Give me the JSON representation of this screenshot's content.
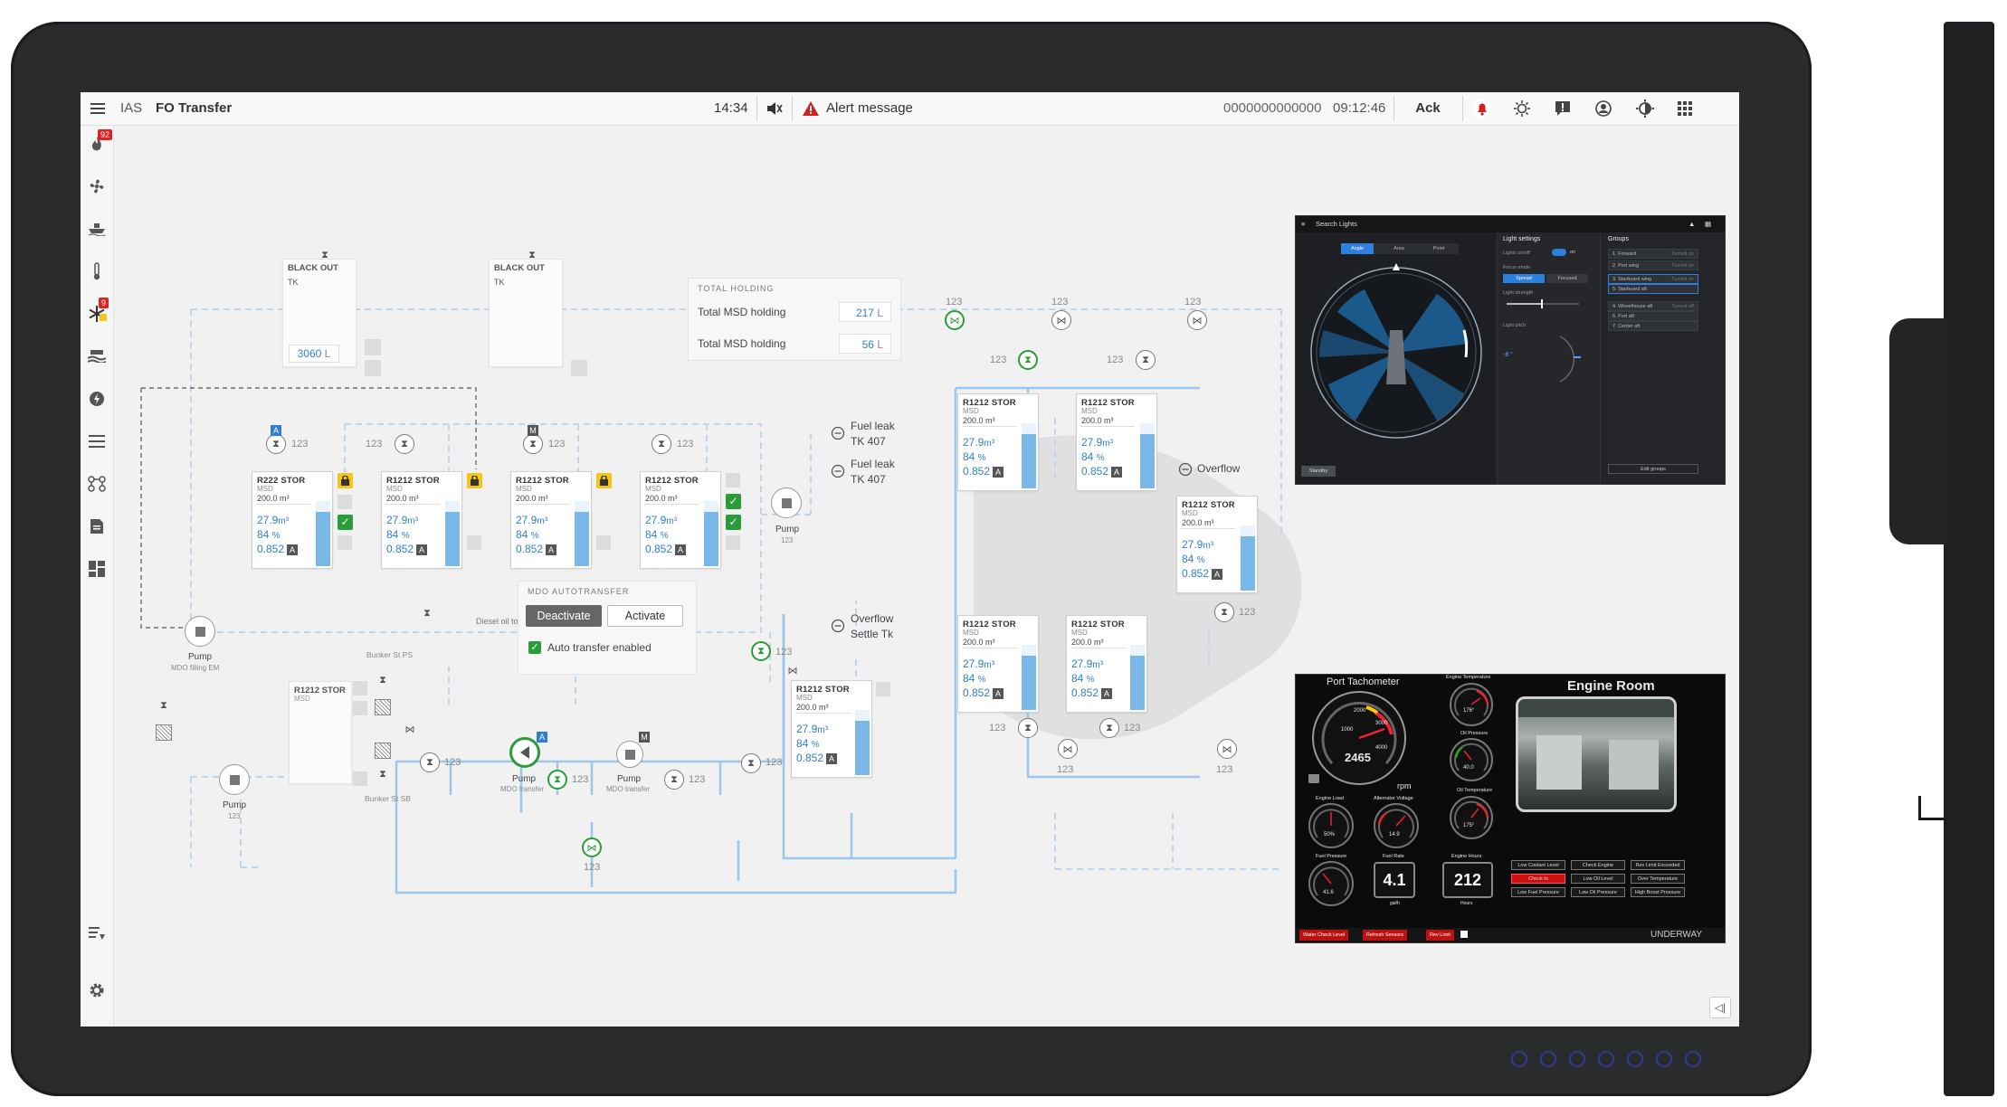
{
  "topbar": {
    "system": "IAS",
    "title": "FO Transfer",
    "time": "14:34",
    "alert_message": "Alert message",
    "alert_id": "0000000000000",
    "alert_time": "09:12:46",
    "ack_label": "Ack"
  },
  "sidebar": {
    "items": [
      {
        "icon": "flame-icon",
        "badge": "92"
      },
      {
        "icon": "fan-icon"
      },
      {
        "icon": "ship-icon"
      },
      {
        "icon": "thermometer-icon"
      },
      {
        "icon": "snowflake-icon",
        "badge": "9"
      },
      {
        "icon": "waves-icon"
      },
      {
        "icon": "power-icon"
      },
      {
        "icon": "list-icon"
      },
      {
        "icon": "network-icon"
      },
      {
        "icon": "document-icon"
      },
      {
        "icon": "dashboard-icon"
      },
      {
        "icon": "filter-list-icon"
      },
      {
        "icon": "gear-icon"
      }
    ]
  },
  "diagram": {
    "blackout_tank_1": {
      "name": "BLACK OUT",
      "sub": "TK",
      "value": "3060",
      "unit": "L"
    },
    "blackout_tank_2": {
      "name": "BLACK OUT",
      "sub": "TK"
    },
    "total_holding": {
      "title": "TOTAL HOLDING",
      "rows": [
        {
          "label": "Total MSD holding",
          "value": "217",
          "unit": "L"
        },
        {
          "label": "Total MSD holding",
          "value": "56",
          "unit": "L"
        }
      ]
    },
    "tanks": [
      {
        "name": "R222 STOR",
        "sub": "MSD",
        "cap": "200.0 m³",
        "vol": "27.9",
        "vol_unit": "m³",
        "pct": "84",
        "pct_unit": "%",
        "den": "0.852",
        "level": 0.84
      },
      {
        "name": "R1212 STOR",
        "sub": "MSD",
        "cap": "200.0 m³",
        "vol": "27.9",
        "vol_unit": "m³",
        "pct": "84",
        "pct_unit": "%",
        "den": "0.852",
        "level": 0.84
      },
      {
        "name": "R1212 STOR",
        "sub": "MSD",
        "cap": "200.0 m³",
        "vol": "27.9",
        "vol_unit": "m³",
        "pct": "84",
        "pct_unit": "%",
        "den": "0.852",
        "level": 0.84
      },
      {
        "name": "R1212 STOR",
        "sub": "MSD",
        "cap": "200.0 m³",
        "vol": "27.9",
        "vol_unit": "m³",
        "pct": "84",
        "pct_unit": "%",
        "den": "0.852",
        "level": 0.84
      },
      {
        "name": "R1212 STOR",
        "sub": "MSD",
        "cap": "200.0 m³",
        "vol": "27.9",
        "vol_unit": "m³",
        "pct": "84",
        "pct_unit": "%",
        "den": "0.852",
        "level": 0.84
      },
      {
        "name": "R1212 STOR",
        "sub": "MSD",
        "cap": "200.0 m³",
        "vol": "27.9",
        "vol_unit": "m³",
        "pct": "84",
        "pct_unit": "%",
        "den": "0.852",
        "level": 0.84
      },
      {
        "name": "R1212 STOR",
        "sub": "MSD",
        "cap": "200.0 m³",
        "vol": "27.9",
        "vol_unit": "m³",
        "pct": "84",
        "pct_unit": "%",
        "den": "0.852",
        "level": 0.84
      },
      {
        "name": "R1212 STOR",
        "sub": "MSD",
        "cap": "200.0 m³",
        "vol": "27.9",
        "vol_unit": "m³",
        "pct": "84",
        "pct_unit": "%",
        "den": "0.852",
        "level": 0.84
      },
      {
        "name": "R1212 STOR",
        "sub": "MSD",
        "cap": "200.0 m³",
        "vol": "27.9",
        "vol_unit": "m³",
        "pct": "84",
        "pct_unit": "%",
        "den": "0.852",
        "level": 0.84
      },
      {
        "name": "R1212 STOR",
        "sub": "MSD",
        "cap": "200.0 m³",
        "vol": "27.9",
        "vol_unit": "m³",
        "pct": "84",
        "pct_unit": "%",
        "den": "0.852",
        "level": 0.84
      }
    ],
    "empty_tank": {
      "name": "R1212 STOR",
      "sub": "MSD"
    },
    "tag": "123",
    "labels": {
      "fuel_leak_1": "Fuel leak",
      "fuel_leak_1b": "TK 407",
      "fuel_leak_2": "Fuel leak",
      "fuel_leak_2b": "TK 407",
      "overflow": "Overflow",
      "overflow_settle": "Overflow",
      "overflow_settle_b": "Settle Tk",
      "diesel_line": "Diesel oil to Emergency Gen tank",
      "bunker_ps": "Bunker St PS",
      "bunker_sb": "Bunker St SB"
    },
    "pumps": [
      {
        "label": "Pump",
        "sub": "123"
      },
      {
        "label": "Pump",
        "sub": "MDO filling EM"
      },
      {
        "label": "Pump",
        "sub": "123"
      },
      {
        "label": "Pump",
        "sub": "MDO transfer"
      },
      {
        "label": "Pump",
        "sub": "MDO transfer"
      }
    ],
    "mdo_autotransfer": {
      "title": "MDO AUTOTRANSFER",
      "deactivate": "Deactivate",
      "activate": "Activate",
      "checkbox_label": "Auto transfer enabled"
    }
  },
  "search_lights": {
    "title": "Search Lights",
    "tabs": [
      "Angle",
      "Area",
      "Point"
    ],
    "light_settings": "Light settings",
    "lights_on": "Lights on/off",
    "on": "on",
    "focus_mode": "Focus mode",
    "spread": "Spread",
    "focused": "Focused",
    "light_strength": "Light strength",
    "light_pitch": "Light pitch",
    "pitch_value": "-8 °",
    "standby": "Standby",
    "groups_title": "Groups",
    "groups": [
      {
        "label": "1. Forward",
        "status": "Turned on"
      },
      {
        "label": "2. Port wing",
        "status": "Turned on"
      },
      {
        "label": "3. Starboard wing",
        "status": "Turned on"
      },
      {
        "label": "5. Starboard aft",
        "status": ""
      },
      {
        "label": "4. Wheelhouse aft",
        "status": "Turned off"
      },
      {
        "label": "6. Port aft",
        "status": ""
      },
      {
        "label": "7. Center aft",
        "status": ""
      }
    ],
    "edit_groups": "Edit groups"
  },
  "engine_room": {
    "port_tachometer": "Port Tachometer",
    "rpm_value": "2465",
    "rpm_unit": "rpm",
    "engine_room_title": "Engine Room",
    "engine_temperature": "Engine Temperature",
    "oil_pressure": "Oil Pressure",
    "oil_temperature": "Oil Temperature",
    "engine_load": "Engine Load",
    "alternator_voltage": "Alternator Voltage",
    "fuel_pressure": "Fuel Pressure",
    "fuel_rate": "Fuel Rate",
    "fuel_rate_value": "4.1",
    "fuel_rate_unit": "gal/h",
    "engine_hours": "Engine Hours",
    "engine_hours_value": "212",
    "engine_hours_unit": "Hours",
    "alarms": [
      "Low Coolant Level",
      "Check Engine",
      "Rev Limit Exceeded",
      "Check In",
      "Low Oil Level",
      "Over Temperature",
      "Low Fuel Pressure",
      "Low Oil Pressure",
      "High Boost Pressure"
    ],
    "status": "UNDERWAY",
    "status_bar": [
      "Water Check Level",
      "Refresh Sensors",
      "Rev Limit"
    ],
    "tach_ticks": [
      "1000",
      "2000",
      "3000",
      "4000"
    ],
    "gauge_values": {
      "engine_temp": "176°",
      "oil_pressure": "40.0",
      "oil_temp": "175°",
      "engine_load": "50%",
      "alt_voltage": "14.9",
      "fuel_pressure": "41.6"
    }
  },
  "colors": {
    "accent_blue": "#2f7fcf",
    "pipe_blue": "#9cc6ea",
    "ok_green": "#2a9d3a",
    "alert_red": "#d21f1f",
    "lock_yellow": "#f5c518"
  }
}
